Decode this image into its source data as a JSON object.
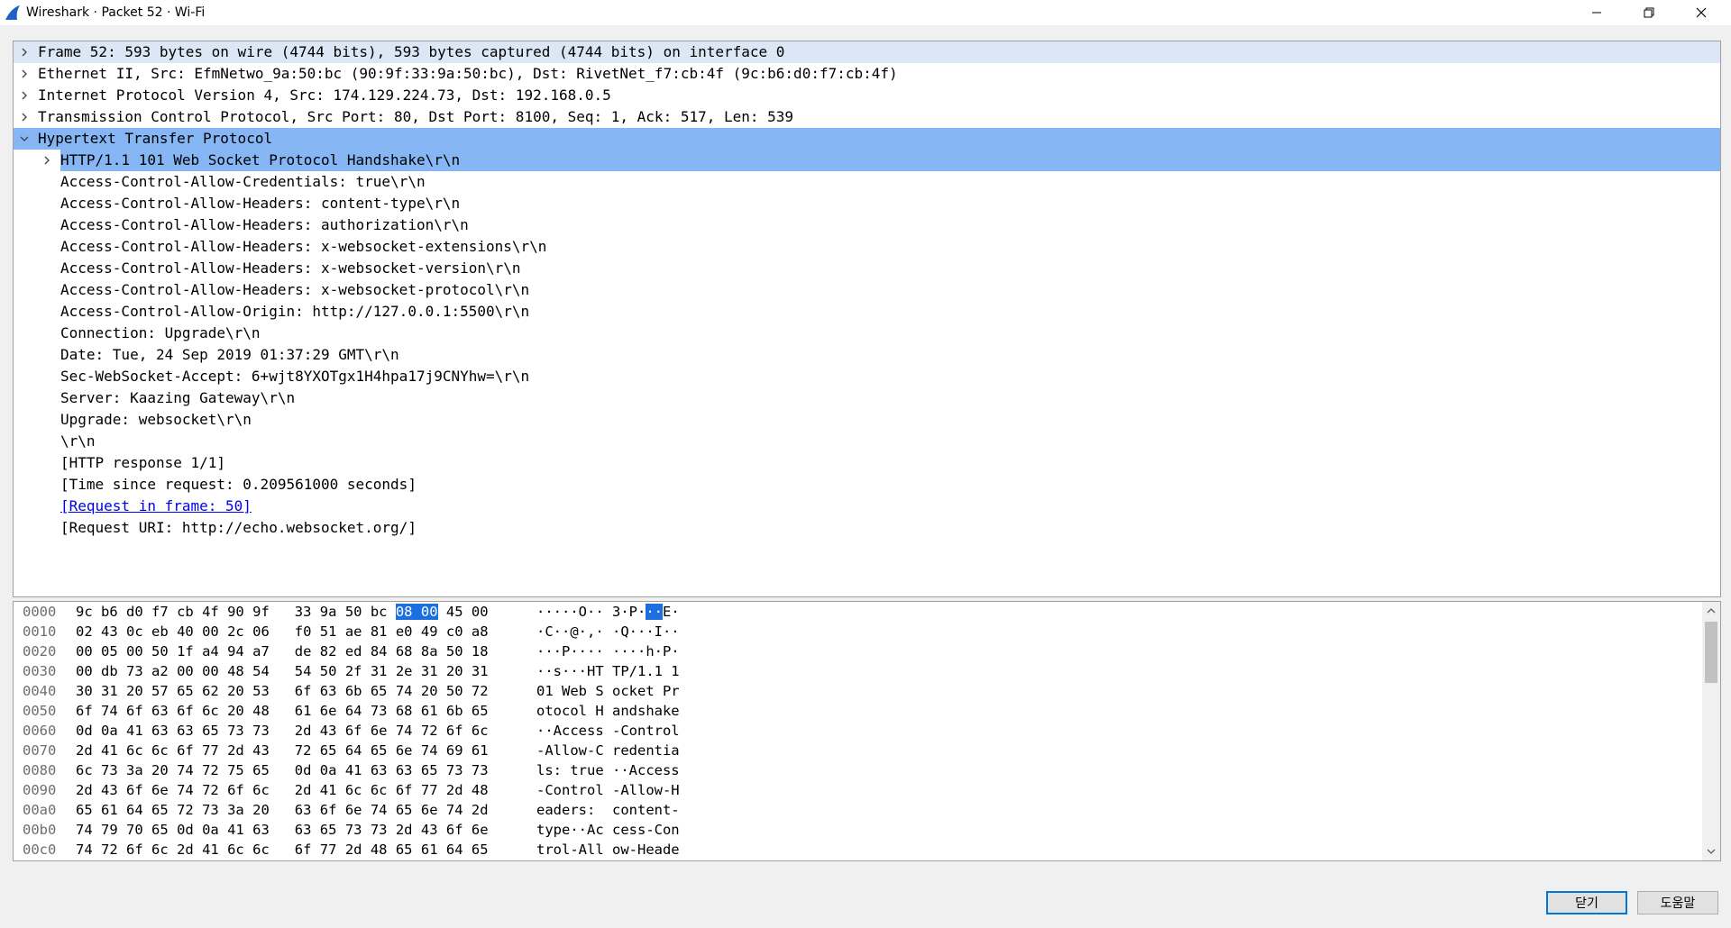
{
  "window": {
    "title": "Wireshark · Packet 52 · Wi-Fi"
  },
  "tree": [
    {
      "text": "Frame 52: 593 bytes on wire (4744 bits), 593 bytes captured (4744 bits) on interface 0",
      "level": 0,
      "expander": "collapsed",
      "style": "lvl1-bg"
    },
    {
      "text": "Ethernet II, Src: EfmNetwo_9a:50:bc (90:9f:33:9a:50:bc), Dst: RivetNet_f7:cb:4f (9c:b6:d0:f7:cb:4f)",
      "level": 0,
      "expander": "collapsed"
    },
    {
      "text": "Internet Protocol Version 4, Src: 174.129.224.73, Dst: 192.168.0.5",
      "level": 0,
      "expander": "collapsed"
    },
    {
      "text": "Transmission Control Protocol, Src Port: 80, Dst Port: 8100, Seq: 1, Ack: 517, Len: 539",
      "level": 0,
      "expander": "collapsed"
    },
    {
      "text": "Hypertext Transfer Protocol",
      "level": 0,
      "expander": "expanded",
      "style": "selected"
    },
    {
      "text": "HTTP/1.1 101 Web Socket Protocol Handshake\\r\\n",
      "level": 1,
      "expander": "collapsed",
      "style": "child-selected"
    },
    {
      "text": "Access-Control-Allow-Credentials: true\\r\\n",
      "level": 1
    },
    {
      "text": "Access-Control-Allow-Headers: content-type\\r\\n",
      "level": 1
    },
    {
      "text": "Access-Control-Allow-Headers: authorization\\r\\n",
      "level": 1
    },
    {
      "text": "Access-Control-Allow-Headers: x-websocket-extensions\\r\\n",
      "level": 1
    },
    {
      "text": "Access-Control-Allow-Headers: x-websocket-version\\r\\n",
      "level": 1
    },
    {
      "text": "Access-Control-Allow-Headers: x-websocket-protocol\\r\\n",
      "level": 1
    },
    {
      "text": "Access-Control-Allow-Origin: http://127.0.0.1:5500\\r\\n",
      "level": 1
    },
    {
      "text": "Connection: Upgrade\\r\\n",
      "level": 1
    },
    {
      "text": "Date: Tue, 24 Sep 2019 01:37:29 GMT\\r\\n",
      "level": 1
    },
    {
      "text": "Sec-WebSocket-Accept: 6+wjt8YXOTgx1H4hpa17j9CNYhw=\\r\\n",
      "level": 1
    },
    {
      "text": "Server: Kaazing Gateway\\r\\n",
      "level": 1
    },
    {
      "text": "Upgrade: websocket\\r\\n",
      "level": 1
    },
    {
      "text": "\\r\\n",
      "level": 1
    },
    {
      "text": "[HTTP response 1/1]",
      "level": 1
    },
    {
      "text": "[Time since request: 0.209561000 seconds]",
      "level": 1
    },
    {
      "text": "[Request in frame: 50]",
      "level": 1,
      "link": true
    },
    {
      "text": "[Request URI: http://echo.websocket.org/]",
      "level": 1
    }
  ],
  "hex": [
    {
      "offset": "0000",
      "bytes": [
        "9c",
        "b6",
        "d0",
        "f7",
        "cb",
        "4f",
        "90",
        "9f",
        "33",
        "9a",
        "50",
        "bc",
        "08",
        "00",
        "45",
        "00"
      ],
      "ascii": "·····O·· 3·P···E·",
      "hl_bytes": [
        12,
        13
      ],
      "ascii_hl": [
        13,
        14
      ]
    },
    {
      "offset": "0010",
      "bytes": [
        "02",
        "43",
        "0c",
        "eb",
        "40",
        "00",
        "2c",
        "06",
        "f0",
        "51",
        "ae",
        "81",
        "e0",
        "49",
        "c0",
        "a8"
      ],
      "ascii": "·C··@·,· ·Q···I··"
    },
    {
      "offset": "0020",
      "bytes": [
        "00",
        "05",
        "00",
        "50",
        "1f",
        "a4",
        "94",
        "a7",
        "de",
        "82",
        "ed",
        "84",
        "68",
        "8a",
        "50",
        "18"
      ],
      "ascii": "···P···· ····h·P·"
    },
    {
      "offset": "0030",
      "bytes": [
        "00",
        "db",
        "73",
        "a2",
        "00",
        "00",
        "48",
        "54",
        "54",
        "50",
        "2f",
        "31",
        "2e",
        "31",
        "20",
        "31"
      ],
      "ascii": "··s···HT TP/1.1 1"
    },
    {
      "offset": "0040",
      "bytes": [
        "30",
        "31",
        "20",
        "57",
        "65",
        "62",
        "20",
        "53",
        "6f",
        "63",
        "6b",
        "65",
        "74",
        "20",
        "50",
        "72"
      ],
      "ascii": "01 Web S ocket Pr"
    },
    {
      "offset": "0050",
      "bytes": [
        "6f",
        "74",
        "6f",
        "63",
        "6f",
        "6c",
        "20",
        "48",
        "61",
        "6e",
        "64",
        "73",
        "68",
        "61",
        "6b",
        "65"
      ],
      "ascii": "otocol H andshake"
    },
    {
      "offset": "0060",
      "bytes": [
        "0d",
        "0a",
        "41",
        "63",
        "63",
        "65",
        "73",
        "73",
        "2d",
        "43",
        "6f",
        "6e",
        "74",
        "72",
        "6f",
        "6c"
      ],
      "ascii": "··Access -Control"
    },
    {
      "offset": "0070",
      "bytes": [
        "2d",
        "41",
        "6c",
        "6c",
        "6f",
        "77",
        "2d",
        "43",
        "72",
        "65",
        "64",
        "65",
        "6e",
        "74",
        "69",
        "61"
      ],
      "ascii": "-Allow-C redentia"
    },
    {
      "offset": "0080",
      "bytes": [
        "6c",
        "73",
        "3a",
        "20",
        "74",
        "72",
        "75",
        "65",
        "0d",
        "0a",
        "41",
        "63",
        "63",
        "65",
        "73",
        "73"
      ],
      "ascii": "ls: true ··Access"
    },
    {
      "offset": "0090",
      "bytes": [
        "2d",
        "43",
        "6f",
        "6e",
        "74",
        "72",
        "6f",
        "6c",
        "2d",
        "41",
        "6c",
        "6c",
        "6f",
        "77",
        "2d",
        "48"
      ],
      "ascii": "-Control -Allow-H"
    },
    {
      "offset": "00a0",
      "bytes": [
        "65",
        "61",
        "64",
        "65",
        "72",
        "73",
        "3a",
        "20",
        "63",
        "6f",
        "6e",
        "74",
        "65",
        "6e",
        "74",
        "2d"
      ],
      "ascii": "eaders:  content-"
    },
    {
      "offset": "00b0",
      "bytes": [
        "74",
        "79",
        "70",
        "65",
        "0d",
        "0a",
        "41",
        "63",
        "63",
        "65",
        "73",
        "73",
        "2d",
        "43",
        "6f",
        "6e"
      ],
      "ascii": "type··Ac cess-Con"
    },
    {
      "offset": "00c0",
      "bytes": [
        "74",
        "72",
        "6f",
        "6c",
        "2d",
        "41",
        "6c",
        "6c",
        "6f",
        "77",
        "2d",
        "48",
        "65",
        "61",
        "64",
        "65"
      ],
      "ascii": "trol-All ow-Heade"
    }
  ],
  "buttons": {
    "close": "닫기",
    "help": "도움말"
  },
  "icons": {
    "app": "wireshark-fin-icon",
    "minimize": "minimize-icon",
    "maximize": "restore-icon",
    "close": "close-icon",
    "collapsed": "chevron-right-icon",
    "expanded": "chevron-down-icon"
  },
  "colors": {
    "selected_row": "#86b7f4",
    "frame_row": "#dbe7f5",
    "hex_highlight": "#1c6fe0",
    "link": "#0000ee"
  }
}
